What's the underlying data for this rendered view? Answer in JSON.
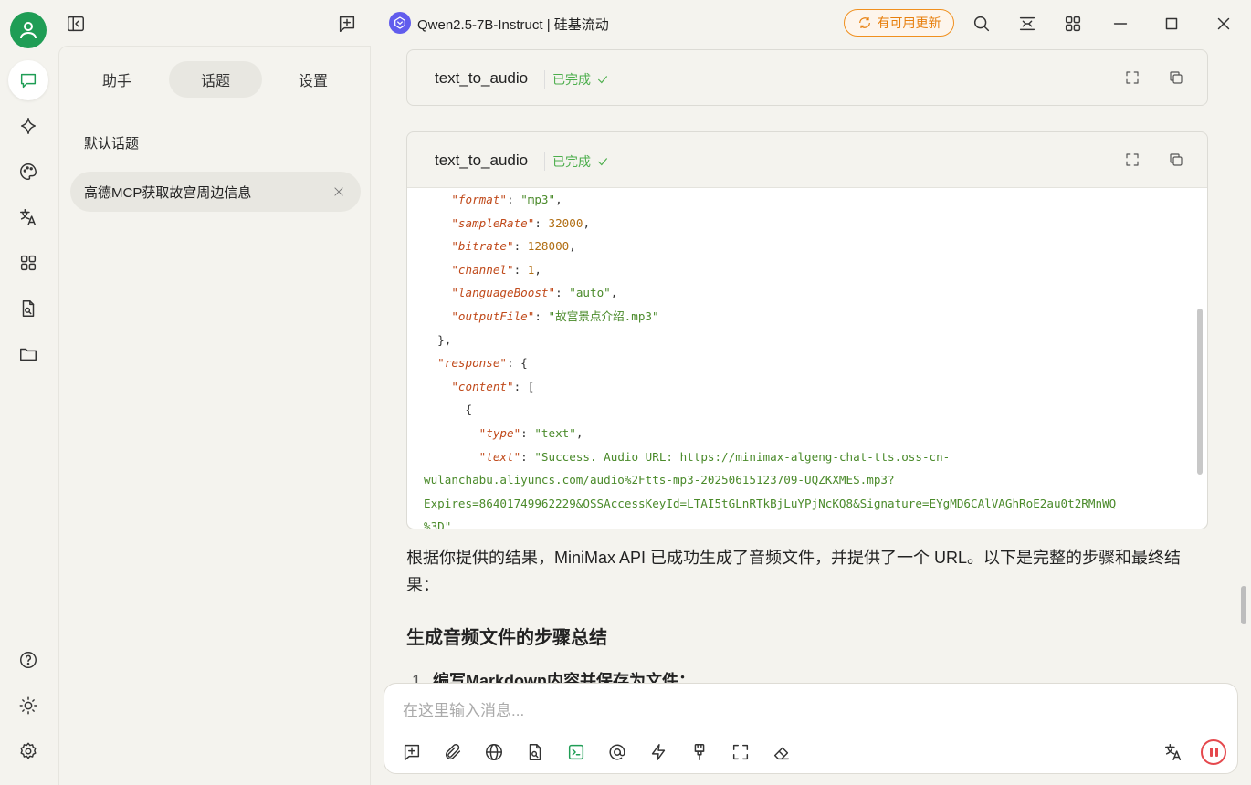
{
  "window": {
    "model_title": "Qwen2.5-7B-Instruct | 硅基流动",
    "update_label": "有可用更新",
    "accent_color": "#1f9d55",
    "update_color": "#e77f0d"
  },
  "panel": {
    "tabs": [
      {
        "label": "助手",
        "active": false
      },
      {
        "label": "话题",
        "active": true
      },
      {
        "label": "设置",
        "active": false
      }
    ],
    "topics": [
      {
        "label": "默认话题",
        "active": false
      },
      {
        "label": "高德MCP获取故宫周边信息",
        "active": true
      }
    ]
  },
  "tool_cards": [
    {
      "name": "text_to_audio",
      "status": "已完成"
    },
    {
      "name": "text_to_audio",
      "status": "已完成"
    }
  ],
  "code_lines": [
    {
      "indent": "    ",
      "parts": [
        [
          "k",
          "\"format\""
        ],
        [
          "p",
          ": "
        ],
        [
          "s",
          "\"mp3\""
        ],
        [
          "p",
          ","
        ]
      ]
    },
    {
      "indent": "    ",
      "parts": [
        [
          "k",
          "\"sampleRate\""
        ],
        [
          "p",
          ": "
        ],
        [
          "n",
          "32000"
        ],
        [
          "p",
          ","
        ]
      ]
    },
    {
      "indent": "    ",
      "parts": [
        [
          "k",
          "\"bitrate\""
        ],
        [
          "p",
          ": "
        ],
        [
          "n",
          "128000"
        ],
        [
          "p",
          ","
        ]
      ]
    },
    {
      "indent": "    ",
      "parts": [
        [
          "k",
          "\"channel\""
        ],
        [
          "p",
          ": "
        ],
        [
          "n",
          "1"
        ],
        [
          "p",
          ","
        ]
      ]
    },
    {
      "indent": "    ",
      "parts": [
        [
          "k",
          "\"languageBoost\""
        ],
        [
          "p",
          ": "
        ],
        [
          "s",
          "\"auto\""
        ],
        [
          "p",
          ","
        ]
      ]
    },
    {
      "indent": "    ",
      "parts": [
        [
          "k",
          "\"outputFile\""
        ],
        [
          "p",
          ": "
        ],
        [
          "s",
          "\"故宫景点介绍.mp3\""
        ]
      ]
    },
    {
      "indent": "  ",
      "parts": [
        [
          "p",
          "},"
        ]
      ]
    },
    {
      "indent": "  ",
      "parts": [
        [
          "k",
          "\"response\""
        ],
        [
          "p",
          ": {"
        ]
      ]
    },
    {
      "indent": "    ",
      "parts": [
        [
          "k",
          "\"content\""
        ],
        [
          "p",
          ": ["
        ]
      ]
    },
    {
      "indent": "      ",
      "parts": [
        [
          "p",
          "{"
        ]
      ]
    },
    {
      "indent": "        ",
      "parts": [
        [
          "k",
          "\"type\""
        ],
        [
          "p",
          ": "
        ],
        [
          "s",
          "\"text\""
        ],
        [
          "p",
          ","
        ]
      ]
    },
    {
      "indent": "        ",
      "parts": [
        [
          "k",
          "\"text\""
        ],
        [
          "p",
          ": "
        ],
        [
          "s",
          "\"Success. Audio URL: https://minimax-algeng-chat-tts.oss-cn-"
        ]
      ]
    },
    {
      "indent": "",
      "parts": [
        [
          "s",
          "wulanchabu.aliyuncs.com/audio%2Ftts-mp3-20250615123709-UQZKXMES.mp3?"
        ]
      ]
    },
    {
      "indent": "",
      "parts": [
        [
          "s",
          "Expires=86401749962229&OSSAccessKeyId=LTAI5tGLnRTkBjLuYPjNcKQ8&Signature=EYgMD6CAlVAGhRoE2au0t2RMnWQ"
        ]
      ]
    },
    {
      "indent": "",
      "parts": [
        [
          "s",
          "%3D\""
        ]
      ]
    }
  ],
  "answer": {
    "paragraph": "根据你提供的结果，MiniMax API 已成功生成了音频文件，并提供了一个 URL。以下是完整的步骤和最终结果：",
    "heading": "生成音频文件的步骤总结",
    "list_number": "1.",
    "list_item": "编写Markdown内容并保存为文件："
  },
  "input": {
    "placeholder": "在这里输入消息..."
  }
}
